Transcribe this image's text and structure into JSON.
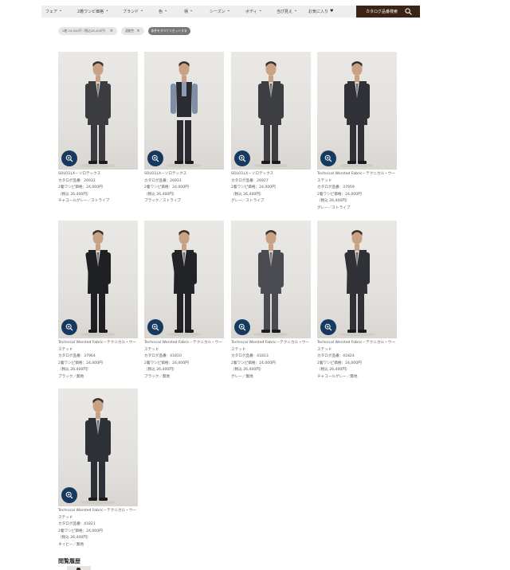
{
  "nav": {
    "items": [
      {
        "label": "フェア",
        "width": 40
      },
      {
        "label": "2着ワンピ価格",
        "width": 57
      },
      {
        "label": "ブランド",
        "width": 45
      },
      {
        "label": "色",
        "width": 32
      },
      {
        "label": "柄",
        "width": 32
      },
      {
        "label": "シーズン",
        "width": 45
      },
      {
        "label": "ボディ",
        "width": 39
      },
      {
        "label": "当ぴ見え",
        "width": 40
      },
      {
        "label": "お気に入り",
        "width": 32
      }
    ],
    "search_label": "カタログ品番検索"
  },
  "filters": {
    "chips": [
      "2着 24,000円（税込26,400円）",
      "濃紺色"
    ],
    "reset_label": "条件をすべてリセットする"
  },
  "products": [
    {
      "name": "SOLO1LX－ソロテックス",
      "code": "カタログ品番：26932",
      "price": "2着ワンピ価格：24,000円",
      "tax": "（税込 26,400円）",
      "color": "チャコールグレー／ストライプ"
    },
    {
      "name": "SOLO1LX－ソロテックス",
      "code": "カタログ品番：26931",
      "price": "2着ワンピ価格：24,000円",
      "tax": "（税込 26,400円）",
      "color": "ブラック／ストライプ"
    },
    {
      "name": "SOLO1LX－ソロテックス",
      "code": "カタログ品番：26927",
      "price": "2着ワンピ価格：24,000円",
      "tax": "（税込 26,400円）",
      "color": "グレー／ストライプ"
    },
    {
      "name": "Technical Worsted Fabric－テクニカル・ウーステッド",
      "code": "カタログ品番：37959",
      "price": "2着ワンピ価格：24,000円",
      "tax": "（税込 26,400円）",
      "color": "グレー／ストライプ"
    },
    {
      "name": "Technical Worsted Fabric－テクニカル・ウーステッド",
      "code": "カタログ品番：37964",
      "price": "2着ワンピ価格：24,000円",
      "tax": "（税込 26,400円）",
      "color": "ブラック／無地"
    },
    {
      "name": "Technical Worsted Fabric－テクニカル・ウーステッド",
      "code": "カタログ品番：41810",
      "price": "2着ワンピ価格：24,000円",
      "tax": "（税込 26,400円）",
      "color": "ブラック／無地"
    },
    {
      "name": "Technical Worsted Fabric－テクニカル・ウーステッド",
      "code": "カタログ品番：41813",
      "price": "2着ワンピ価格：24,000円",
      "tax": "（税込 26,400円）",
      "color": "グレー／無地"
    },
    {
      "name": "Technical Worsted Fabric－テクニカル・ウーステッド",
      "code": "カタログ品番：41824",
      "price": "2着ワンピ価格：24,000円",
      "tax": "（税込 26,400円）",
      "color": "チャコールグレー／無地"
    },
    {
      "name": "Technical Worsted Fabric－テクニカル・ウーステッド",
      "code": "カタログ品番：41821",
      "price": "2着ワンピ価格：24,000円",
      "tax": "（税込 26,400円）",
      "color": "ネイビー／無地"
    }
  ],
  "history": {
    "title": "閲覧履歴"
  },
  "icons": {
    "search": "search-icon",
    "zoom": "zoom-in-icon",
    "heart": "heart-icon",
    "chevron": "chevron-down-icon"
  },
  "colors": {
    "accent_dark_brown": "#3c2415",
    "zoom_button": "#163a5f",
    "nav_bg": "#eeeeee"
  }
}
